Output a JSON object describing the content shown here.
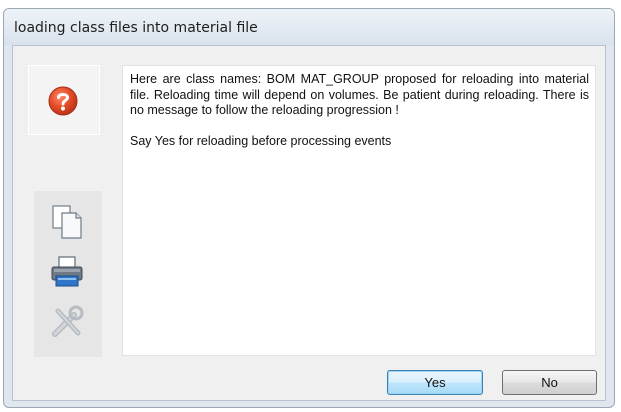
{
  "window": {
    "title": "loading class files into material file"
  },
  "icons": {
    "question": "question-icon",
    "copy": "copy-icon",
    "print": "printer-icon",
    "settings": "tools-icon"
  },
  "message": {
    "paragraph": "Here are class names: BOM MAT_GROUP proposed for reloading into material file. Reloading time will depend on volumes. Be patient during reloading. There is no message to follow the reloading progression !",
    "instruction": "Say Yes for reloading before processing events"
  },
  "buttons": {
    "yes": "Yes",
    "no": "No"
  },
  "colors": {
    "question_icon": "#e24b26",
    "default_button_border": "#3c7fb1"
  }
}
